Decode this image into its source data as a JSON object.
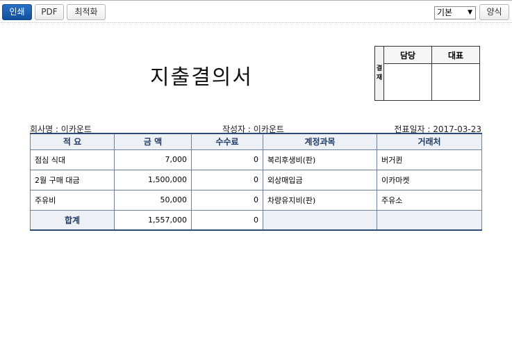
{
  "toolbar": {
    "print_label": "인쇄",
    "pdf_label": "PDF",
    "optimize_label": "최적화",
    "format_select_value": "기본",
    "format_button_label": "양식"
  },
  "document": {
    "title": "지출결의서",
    "approval": {
      "side_label_1": "결",
      "side_label_2": "재",
      "col1": "담당",
      "col2": "대표"
    },
    "company_label": "회사명 : 이카운트",
    "author_label": "작성자 : 이카운트",
    "date_label": "전표일자 : 2017-03-23"
  },
  "table": {
    "headers": [
      "적 요",
      "금 액",
      "수수료",
      "계정과목",
      "거래처"
    ],
    "rows": [
      [
        "점심 식대",
        "7,000",
        "0",
        "복리후생비(판)",
        "버거퀸"
      ],
      [
        "2월 구매 대금",
        "1,500,000",
        "0",
        "외상매입금",
        "이카마켓"
      ],
      [
        "주유비",
        "50,000",
        "0",
        "차량유지비(판)",
        "주유소"
      ]
    ],
    "total": {
      "label": "합계",
      "amount": "1,557,000",
      "fee": "0"
    }
  }
}
